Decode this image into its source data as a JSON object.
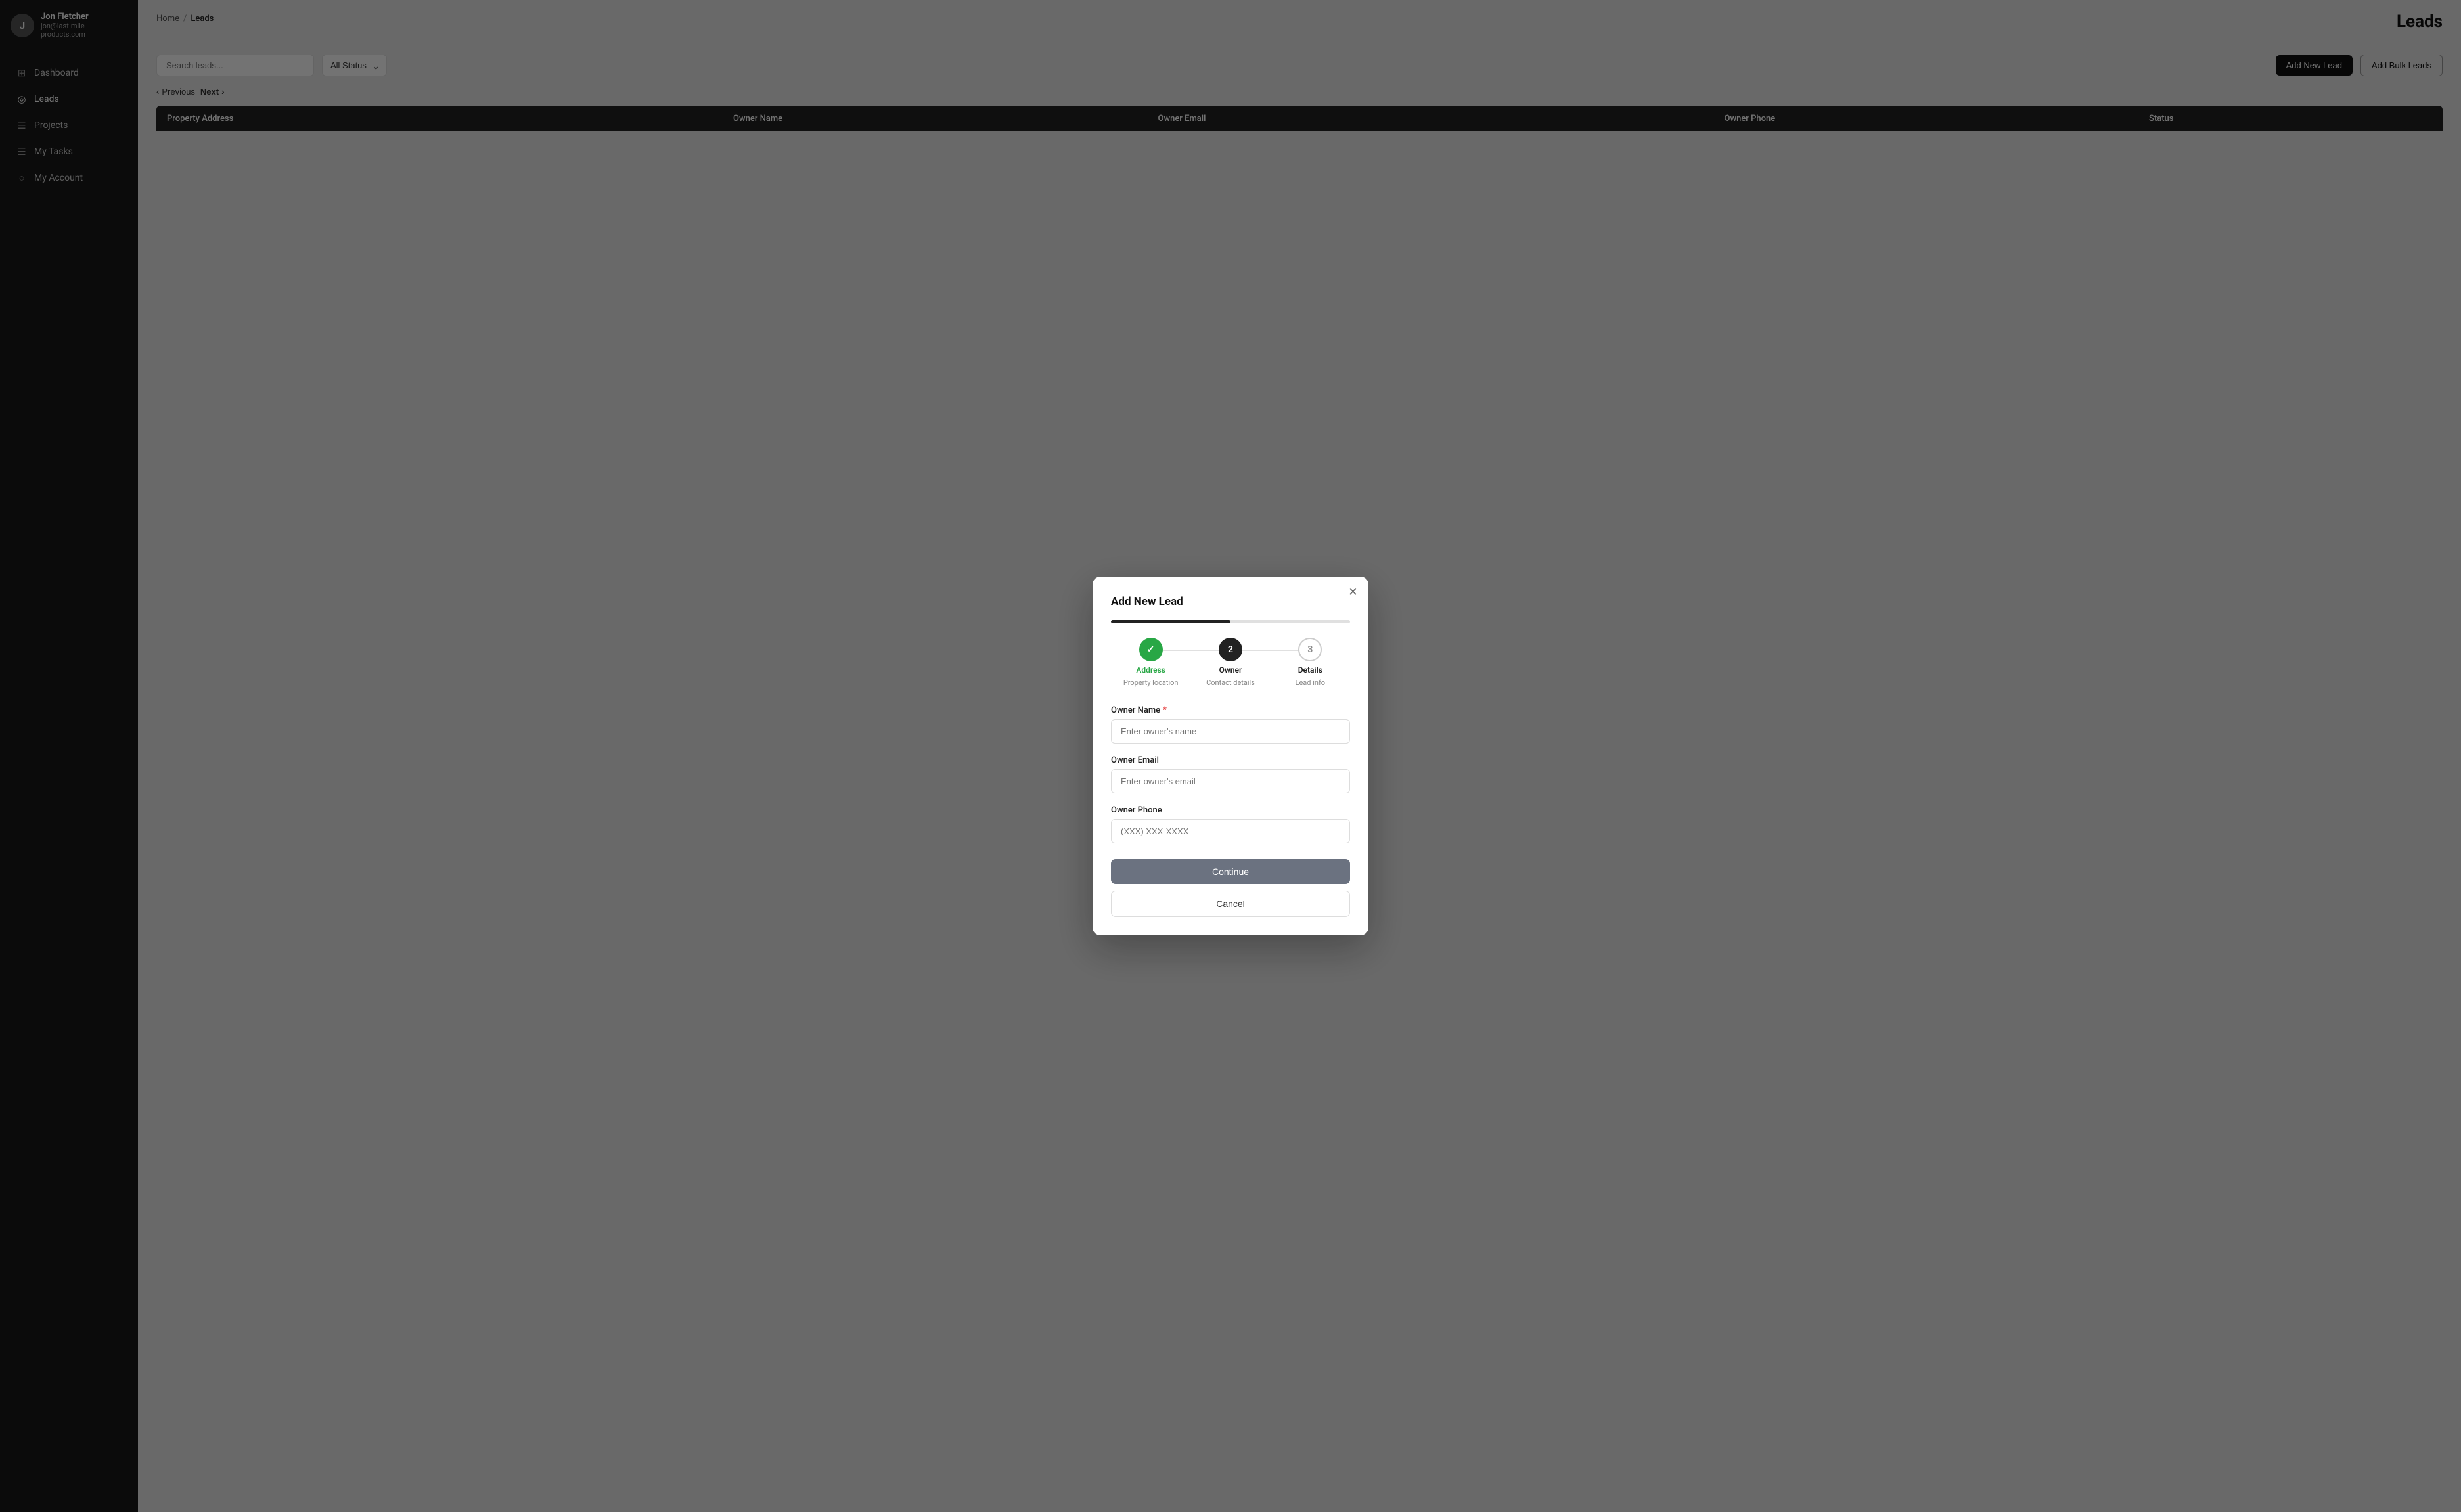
{
  "sidebar": {
    "user": {
      "name": "Jon Fletcher",
      "email": "jon@last-mile-products.com",
      "initial": "J"
    },
    "nav": [
      {
        "id": "dashboard",
        "label": "Dashboard",
        "icon": "⊞",
        "active": false
      },
      {
        "id": "leads",
        "label": "Leads",
        "icon": "◎",
        "active": true
      },
      {
        "id": "projects",
        "label": "Projects",
        "icon": "☰",
        "active": false
      },
      {
        "id": "my-tasks",
        "label": "My Tasks",
        "icon": "☰",
        "active": false
      },
      {
        "id": "my-account",
        "label": "My Account",
        "icon": "○",
        "active": false
      }
    ]
  },
  "breadcrumb": {
    "home": "Home",
    "sep": "/",
    "current": "Leads"
  },
  "page": {
    "title": "Leads"
  },
  "toolbar": {
    "search_placeholder": "Search leads...",
    "status_label": "All Status",
    "add_new_label": "Add New Lead",
    "add_bulk_label": "Add Bulk Leads"
  },
  "pagination": {
    "previous": "Previous",
    "next": "Next"
  },
  "table": {
    "headers": [
      "Property Address",
      "Owner Name",
      "Owner Email",
      "Owner Phone",
      "Status"
    ]
  },
  "modal": {
    "title": "Add New Lead",
    "progress_pct": 50,
    "steps": [
      {
        "id": "address",
        "number": "✓",
        "type": "done",
        "label": "Address",
        "sublabel": "Property location",
        "label_class": "active-green"
      },
      {
        "id": "owner",
        "number": "2",
        "type": "active",
        "label": "Owner",
        "sublabel": "Contact details",
        "label_class": ""
      },
      {
        "id": "details",
        "number": "3",
        "type": "pending",
        "label": "Details",
        "sublabel": "Lead info",
        "label_class": ""
      }
    ],
    "form": {
      "owner_name_label": "Owner Name",
      "owner_name_required": true,
      "owner_name_placeholder": "Enter owner's name",
      "owner_email_label": "Owner Email",
      "owner_email_placeholder": "Enter owner's email",
      "owner_phone_label": "Owner Phone",
      "owner_phone_placeholder": "(XXX) XXX-XXXX"
    },
    "continue_label": "Continue",
    "cancel_label": "Cancel"
  }
}
